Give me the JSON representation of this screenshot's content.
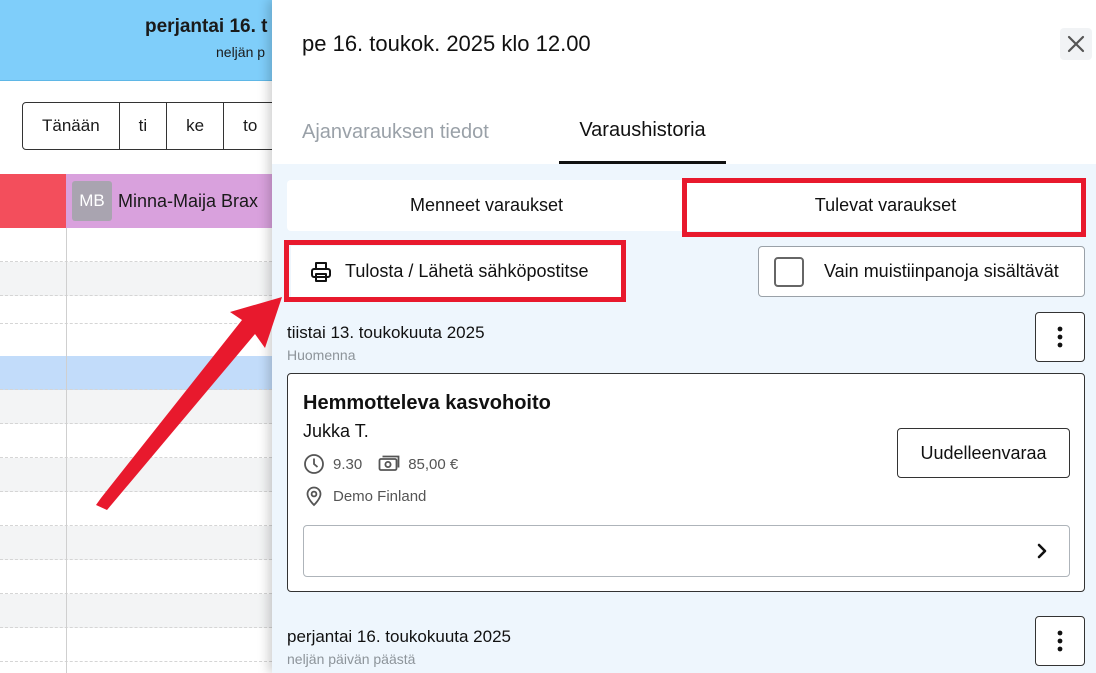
{
  "calendar": {
    "date_heading": "perjantai 16. t",
    "relative_heading": "neljän p",
    "nav_buttons": [
      "Tänään",
      "ti",
      "ke",
      "to"
    ],
    "staff": {
      "initials": "MB",
      "name": "Minna-Maija Brax"
    },
    "colors": {
      "header": "#7fcefa",
      "staff_column": "#d9a1dd",
      "red_column": "#f34e5c",
      "selected_slot": "#c2dcfa"
    }
  },
  "panel": {
    "title": "pe 16. toukok. 2025 klo 12.00",
    "close_icon": "close-icon",
    "tabs": [
      {
        "label": "Ajanvarauksen tiedot",
        "active": false
      },
      {
        "label": "Varaushistoria",
        "active": true
      }
    ],
    "segments": {
      "past": "Menneet varaukset",
      "upcoming": "Tulevat varaukset"
    },
    "print_label": "Tulosta / Lähetä sähköpostitse",
    "print_icon": "printer-icon",
    "notes_filter_label": "Vain muistiinpanoja sisältävät",
    "notes_filter_checked": false,
    "days": [
      {
        "heading": "tiistai 13. toukokuuta 2025",
        "relative": "Huomenna",
        "booking": {
          "service": "Hemmotteleva kasvohoito",
          "customer": "Jukka T.",
          "time": "9.30",
          "price": "85,00 €",
          "location": "Demo Finland",
          "rebook_label": "Uudelleenvaraa"
        }
      },
      {
        "heading": "perjantai 16. toukokuuta 2025",
        "relative": "neljän päivän päästä"
      }
    ],
    "highlight_color": "#e8192d"
  }
}
